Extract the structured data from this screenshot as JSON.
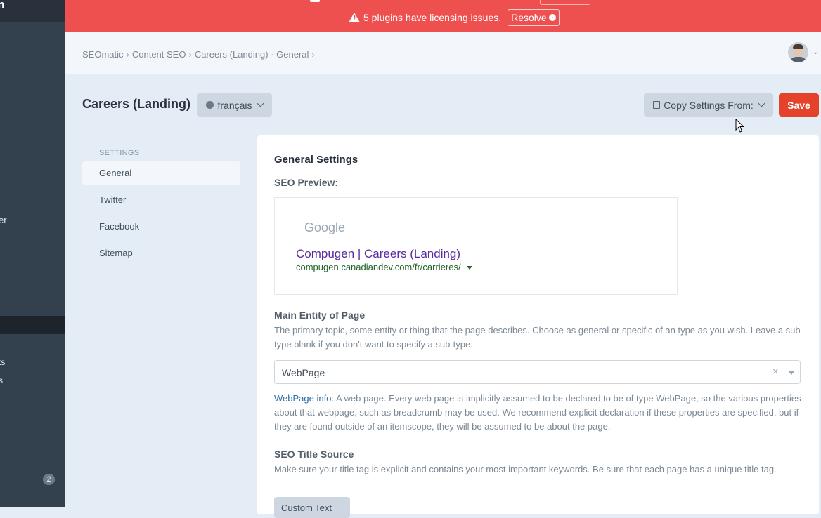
{
  "sidebar": {
    "top_text": "n",
    "items": [
      "er",
      "ts",
      "s"
    ],
    "badge": "2"
  },
  "banner": {
    "message": "5 plugins have licensing issues.",
    "resolve_label": "Resolve"
  },
  "header": {
    "breadcrumbs": [
      "SEOmatic",
      "Content SEO",
      "Careers (Landing) · General"
    ]
  },
  "page": {
    "title": "Careers (Landing)",
    "language": "français",
    "copy_settings_label": "Copy Settings From:",
    "save_label": "Save"
  },
  "settings_nav": {
    "heading": "SETTINGS",
    "items": [
      "General",
      "Twitter",
      "Facebook",
      "Sitemap"
    ],
    "active": "General"
  },
  "panel": {
    "title": "General Settings",
    "seo_preview_label": "SEO Preview:",
    "preview": {
      "logo": "Google",
      "title": "Compugen | Careers (Landing)",
      "url": "compugen.canadiandev.com/fr/carrieres/"
    },
    "main_entity": {
      "label": "Main Entity of Page",
      "description": "The primary topic, some entity or thing that the page describes. Choose as general or specific of an type as you wish. Leave a sub-type blank if you don't want to specify a sub-type.",
      "value": "WebPage",
      "info_link": "WebPage info:",
      "info_text": " A web page. Every web page is implicitly assumed to be declared to be of type WebPage, so the various properties about that webpage, such as breadcrumb may be used. We recommend explicit declaration if these properties are specified, but if they are found outside of an itemscope, they will be assumed to be about the page."
    },
    "title_source": {
      "label": "SEO Title Source",
      "description": "Make sure your title tag is explicit and contains your most important keywords. Be sure that each page has a unique title tag.",
      "value": "Custom Text"
    }
  }
}
